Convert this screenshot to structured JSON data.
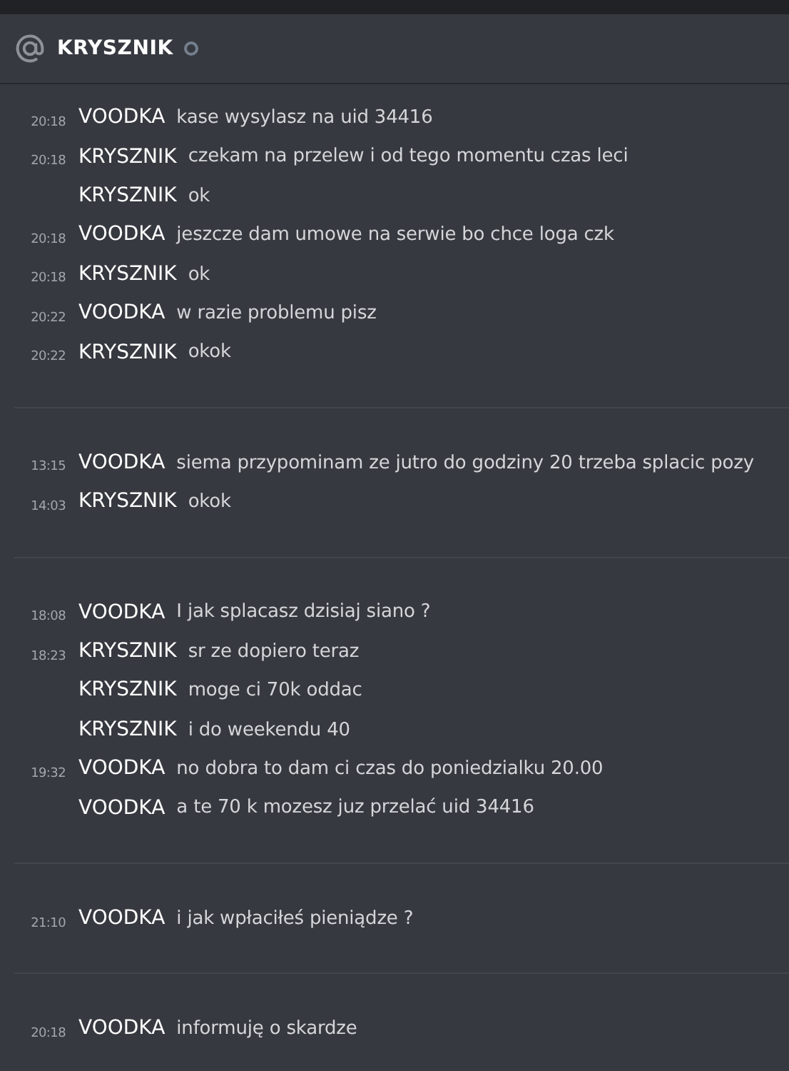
{
  "header": {
    "title": "KRYSZNIK",
    "online": false
  },
  "groups": [
    {
      "messages": [
        {
          "time": "20:18",
          "author": "VOODKA",
          "text": "kase wysylasz na uid 34416"
        },
        {
          "time": "20:18",
          "author": "KRYSZNIK",
          "text": "czekam na przelew i od tego momentu czas leci"
        },
        {
          "author": "KRYSZNIK",
          "text": "ok"
        },
        {
          "time": "20:18",
          "author": "VOODKA",
          "text": "jeszcze dam umowe na serwie bo chce loga czk"
        },
        {
          "time": "20:18",
          "author": "KRYSZNIK",
          "text": "ok"
        },
        {
          "time": "20:22",
          "author": "VOODKA",
          "text": "w razie problemu pisz"
        },
        {
          "time": "20:22",
          "author": "KRYSZNIK",
          "text": "okok"
        }
      ]
    },
    {
      "messages": [
        {
          "time": "13:15",
          "author": "VOODKA",
          "text": "siema przypominam ze jutro do godziny 20 trzeba splacic pozy"
        },
        {
          "time": "14:03",
          "author": "KRYSZNIK",
          "text": "okok"
        }
      ]
    },
    {
      "messages": [
        {
          "time": "18:08",
          "author": "VOODKA",
          "text": "I jak splacasz dzisiaj siano ?"
        },
        {
          "time": "18:23",
          "author": "KRYSZNIK",
          "text": "sr ze dopiero teraz"
        },
        {
          "author": "KRYSZNIK",
          "text": "moge ci 70k oddac"
        },
        {
          "author": "KRYSZNIK",
          "text": "i do weekendu 40"
        },
        {
          "time": "19:32",
          "author": "VOODKA",
          "text": "no dobra to dam ci czas do poniedzialku 20.00"
        },
        {
          "author": "VOODKA",
          "text": "a te 70 k mozesz juz przelać uid 34416"
        }
      ]
    },
    {
      "messages": [
        {
          "time": "21:10",
          "author": "VOODKA",
          "text": "i jak wpłaciłeś pieniądze ?"
        }
      ]
    },
    {
      "messages": [
        {
          "time": "20:18",
          "author": "VOODKA",
          "text": "informuję o skardze"
        }
      ]
    }
  ]
}
